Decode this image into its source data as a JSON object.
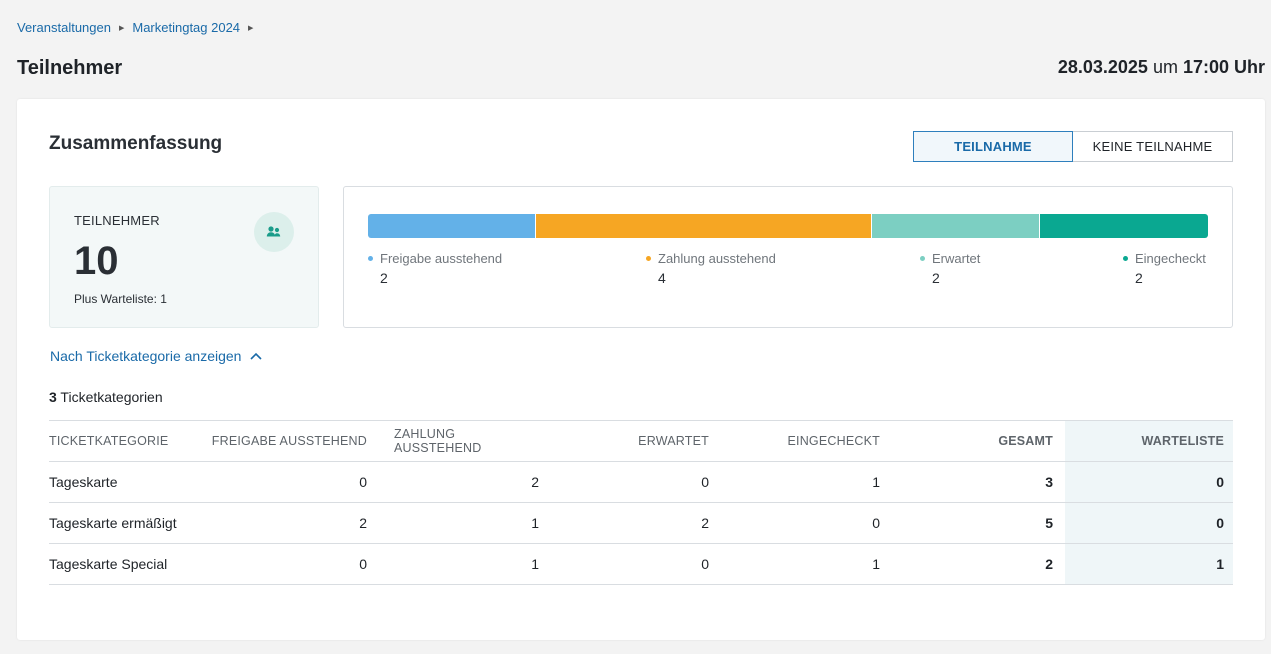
{
  "breadcrumb": {
    "items": [
      "Veranstaltungen",
      "Marketingtag 2024"
    ]
  },
  "page": {
    "title": "Teilnehmer",
    "date": "28.03.2025",
    "date_sep": " um ",
    "time": "17:00 Uhr"
  },
  "summary": {
    "title": "Zusammenfassung",
    "toggle": {
      "active": "TEILNAHME",
      "inactive": "KEINE TEILNAHME"
    },
    "stat": {
      "label": "TEILNEHMER",
      "value": "10",
      "sub": "Plus Warteliste: 1",
      "icon": "users-icon"
    },
    "breakdown": [
      {
        "label": "Freigabe ausstehend",
        "value": 2,
        "color": "#63b1e8"
      },
      {
        "label": "Zahlung ausstehend",
        "value": 4,
        "color": "#f6a623"
      },
      {
        "label": "Erwartet",
        "value": 2,
        "color": "#7ccfc2"
      },
      {
        "label": "Eingecheckt",
        "value": 2,
        "color": "#0aa891"
      }
    ]
  },
  "tickets": {
    "expand_label": "Nach Ticketkategorie anzeigen",
    "count": "3",
    "count_label": " Ticketkategorien",
    "columns": [
      "TICKETKATEGORIE",
      "FREIGABE AUSSTEHEND",
      "ZAHLUNG AUSSTEHEND",
      "ERWARTET",
      "EINGECHECKT",
      "GESAMT",
      "WARTELISTE"
    ],
    "rows": [
      {
        "name": "Tageskarte",
        "freigabe": "0",
        "zahlung": "2",
        "erwartet": "0",
        "eingecheckt": "1",
        "gesamt": "3",
        "warteliste": "0"
      },
      {
        "name": "Tageskarte ermäßigt",
        "freigabe": "2",
        "zahlung": "1",
        "erwartet": "2",
        "eingecheckt": "0",
        "gesamt": "5",
        "warteliste": "0"
      },
      {
        "name": "Tageskarte Special",
        "freigabe": "0",
        "zahlung": "1",
        "erwartet": "0",
        "eingecheckt": "1",
        "gesamt": "2",
        "warteliste": "1"
      }
    ]
  }
}
